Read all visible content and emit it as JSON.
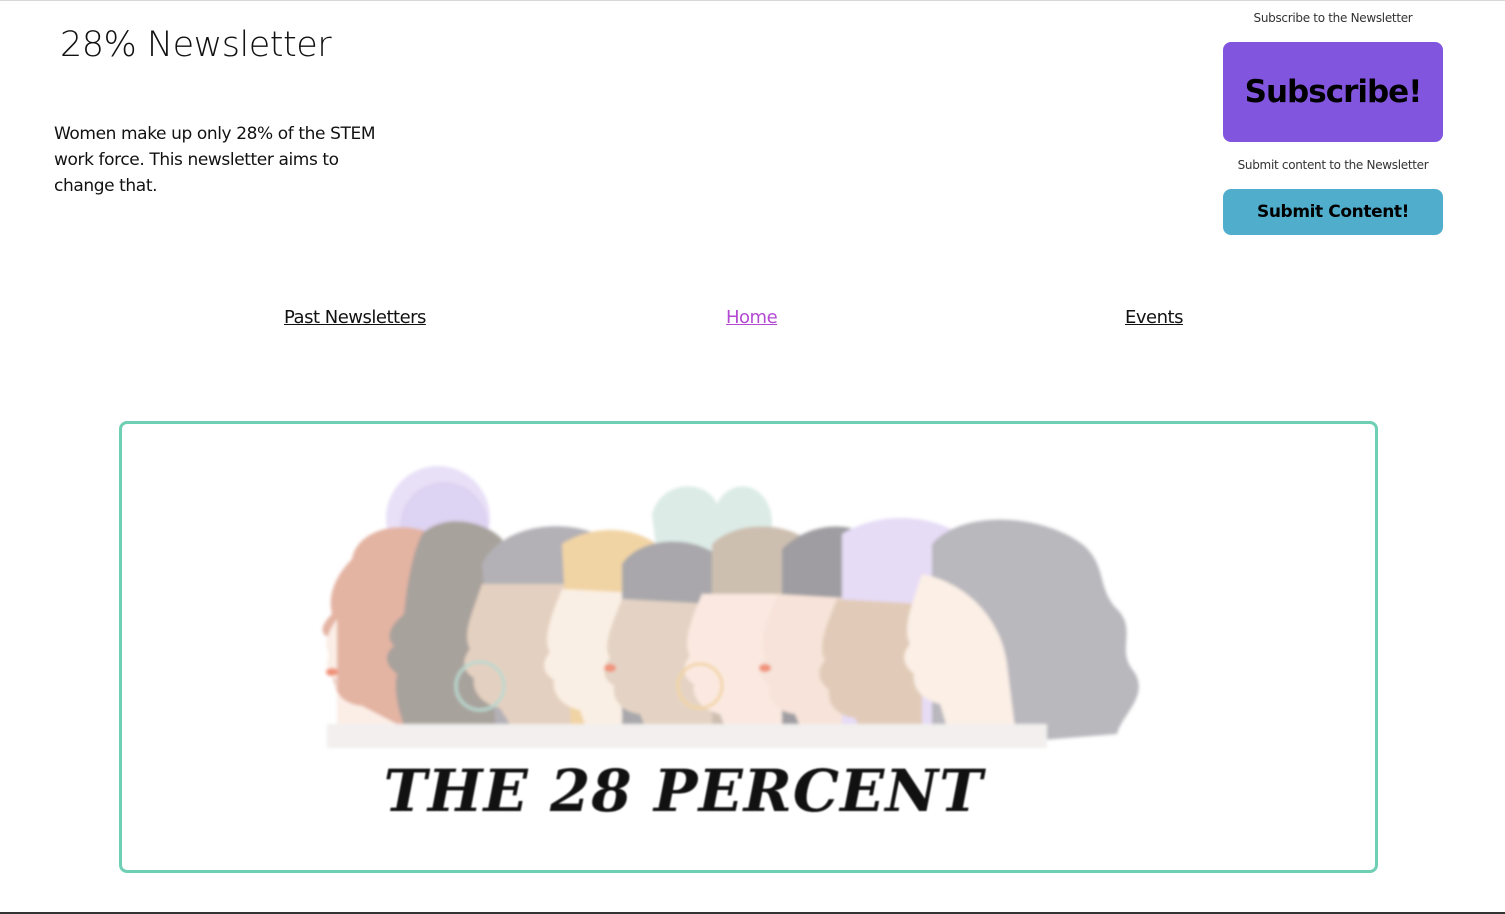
{
  "header": {
    "title": "28% Newsletter",
    "tagline": "Women make up only 28% of the STEM work force. This newsletter aims to change that."
  },
  "side_panel": {
    "subscribe_caption": "Subscribe to the Newsletter",
    "subscribe_label": "Subscribe!",
    "submit_caption": "Submit content to the Newsletter",
    "submit_label": "Submit Content!"
  },
  "nav": {
    "items": [
      {
        "label": "Past Newsletters",
        "active": false
      },
      {
        "label": "Home",
        "active": true
      },
      {
        "label": "Events",
        "active": false
      }
    ]
  },
  "banner": {
    "image_text": "THE 28 PERCENT"
  },
  "colors": {
    "subscribe_button": "#8155dd",
    "submit_button": "#50aecc",
    "banner_border": "#6fcfb4",
    "active_link": "#b44ad4"
  }
}
